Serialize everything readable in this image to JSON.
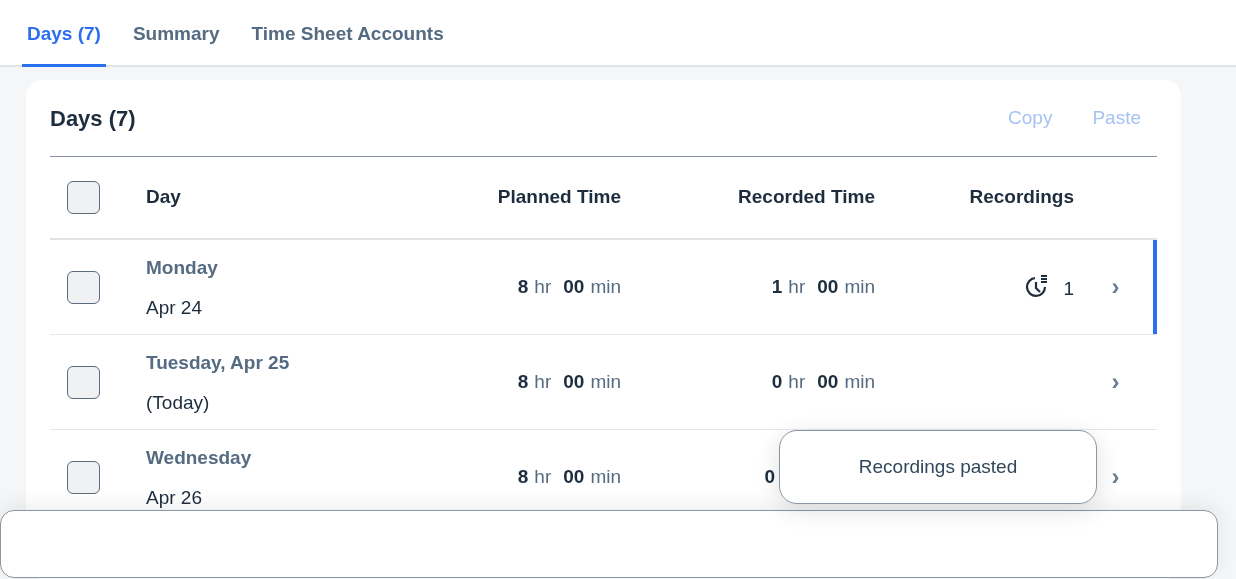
{
  "tabs": [
    {
      "label": "Days (7)",
      "selected": true
    },
    {
      "label": "Summary",
      "selected": false
    },
    {
      "label": "Time Sheet Accounts",
      "selected": false
    }
  ],
  "panel": {
    "title": "Days (7)",
    "actions": [
      {
        "label": "Copy",
        "disabled": true
      },
      {
        "label": "Paste",
        "disabled": true
      }
    ]
  },
  "table": {
    "select_all": {
      "checked": false
    },
    "columns": [
      "Day",
      "Planned Time",
      "Recorded Time",
      "Recordings"
    ],
    "rows": [
      {
        "day": "Monday",
        "date": "Apr 24",
        "checked": false,
        "selected": true,
        "planned": {
          "hours": "8",
          "hr": "hr",
          "minutes": "00",
          "min": "min"
        },
        "recorded": {
          "hours": "1",
          "hr": "hr",
          "minutes": "00",
          "min": "min"
        },
        "recordings": "1",
        "chevron": "›"
      },
      {
        "day": "Tuesday, Apr 25",
        "date": "(Today)",
        "checked": false,
        "selected": false,
        "planned": {
          "hours": "8",
          "hr": "hr",
          "minutes": "00",
          "min": "min"
        },
        "recorded": {
          "hours": "0",
          "hr": "hr",
          "minutes": "00",
          "min": "min"
        },
        "chevron": "›"
      },
      {
        "day": "Wednesday",
        "date": "Apr 26",
        "checked": false,
        "selected": false,
        "planned": {
          "hours": "8",
          "hr": "hr",
          "minutes": "00",
          "min": "min"
        },
        "recorded": {
          "hours": "0"
        },
        "chevron": "›"
      }
    ]
  },
  "toast": {
    "message": "Recordings pasted"
  }
}
